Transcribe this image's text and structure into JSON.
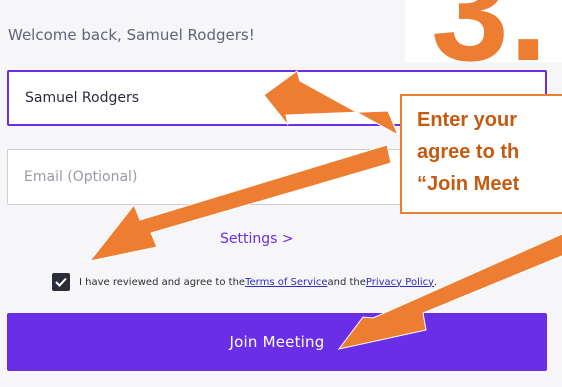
{
  "welcome_text": "Welcome back, Samuel Rodgers!",
  "name_field": {
    "value": "Samuel Rodgers"
  },
  "email_field": {
    "placeholder": "Email (Optional)"
  },
  "settings_link": "Settings >",
  "terms": {
    "checked": true,
    "prefix": "I have reviewed and agree to the ",
    "tos_link": "Terms of Service",
    "middle": " and the ",
    "privacy_link": "Privacy Policy",
    "suffix": "."
  },
  "join_button": "Join Meeting",
  "annotation": {
    "step_number": "3.",
    "callout_lines": [
      "Enter your",
      "agree to th",
      "“Join Meet"
    ]
  },
  "colors": {
    "accent": "#6b2ee7",
    "annotation_orange": "#ed7d31",
    "annotation_text": "#c55a11"
  }
}
